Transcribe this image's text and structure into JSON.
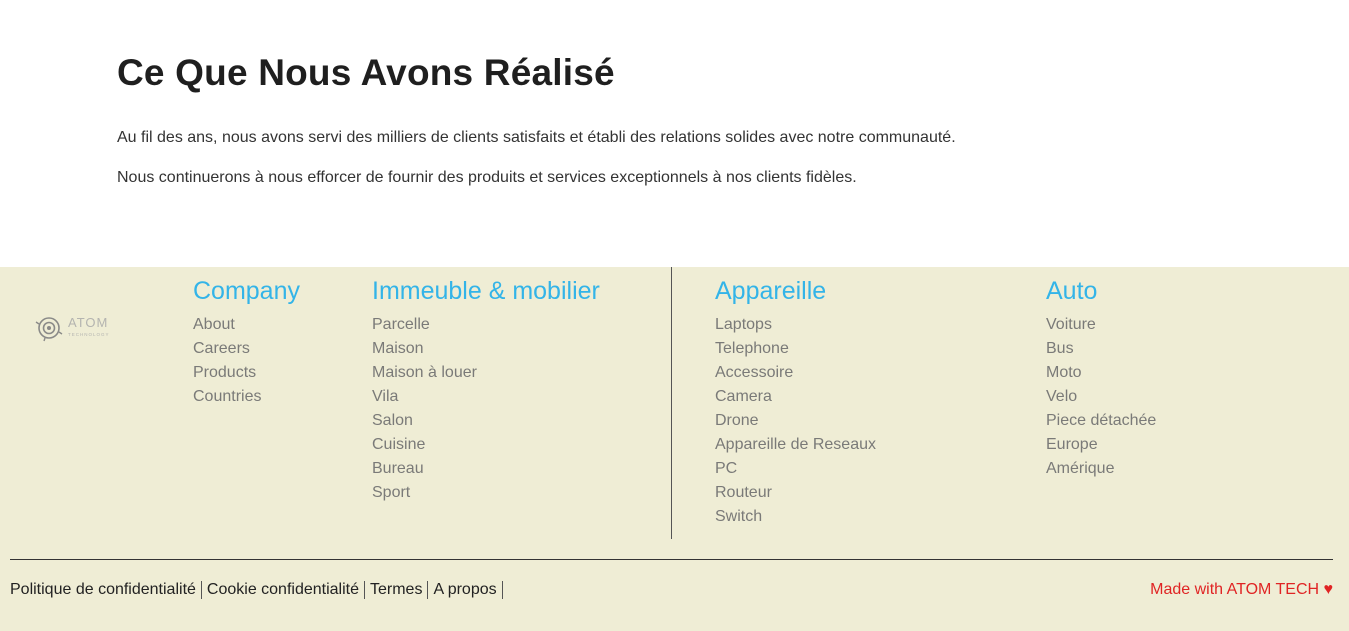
{
  "about": {
    "title": "Ce Que Nous Avons Réalisé",
    "paragraph1": "Au fil des ans, nous avons servi des milliers de clients satisfaits et établi des relations solides avec notre communauté.",
    "paragraph2": "Nous continuerons à nous efforcer de fournir des produits et services exceptionnels à nos clients fidèles."
  },
  "footer": {
    "logo_text": "ATOM",
    "logo_subtext": "TECHNOLOGY",
    "columns": [
      {
        "title": "Company",
        "items": [
          "About",
          "Careers",
          "Products",
          "Countries"
        ]
      },
      {
        "title": "Immeuble & mobilier",
        "items": [
          "Parcelle",
          "Maison",
          "Maison à louer",
          "Vila",
          "Salon",
          "Cuisine",
          "Bureau",
          "Sport"
        ]
      },
      {
        "title": "Appareille",
        "items": [
          "Laptops",
          "Telephone",
          "Accessoire",
          "Camera",
          "Drone",
          "Appareille de Reseaux",
          "PC",
          "Routeur",
          "Switch"
        ]
      },
      {
        "title": "Auto",
        "items": [
          "Voiture",
          "Bus",
          "Moto",
          "Velo",
          "Piece détachée",
          "Europe",
          "Amérique"
        ]
      }
    ],
    "bottom_links": [
      "Politique de confidentialité",
      "Cookie confidentialité",
      "Termes",
      "A propos"
    ],
    "credit": "Made with ATOM TECH ♥"
  },
  "colors": {
    "accent": "#33b4e8",
    "footer_bg": "#efedd5",
    "credit": "#e02424"
  }
}
